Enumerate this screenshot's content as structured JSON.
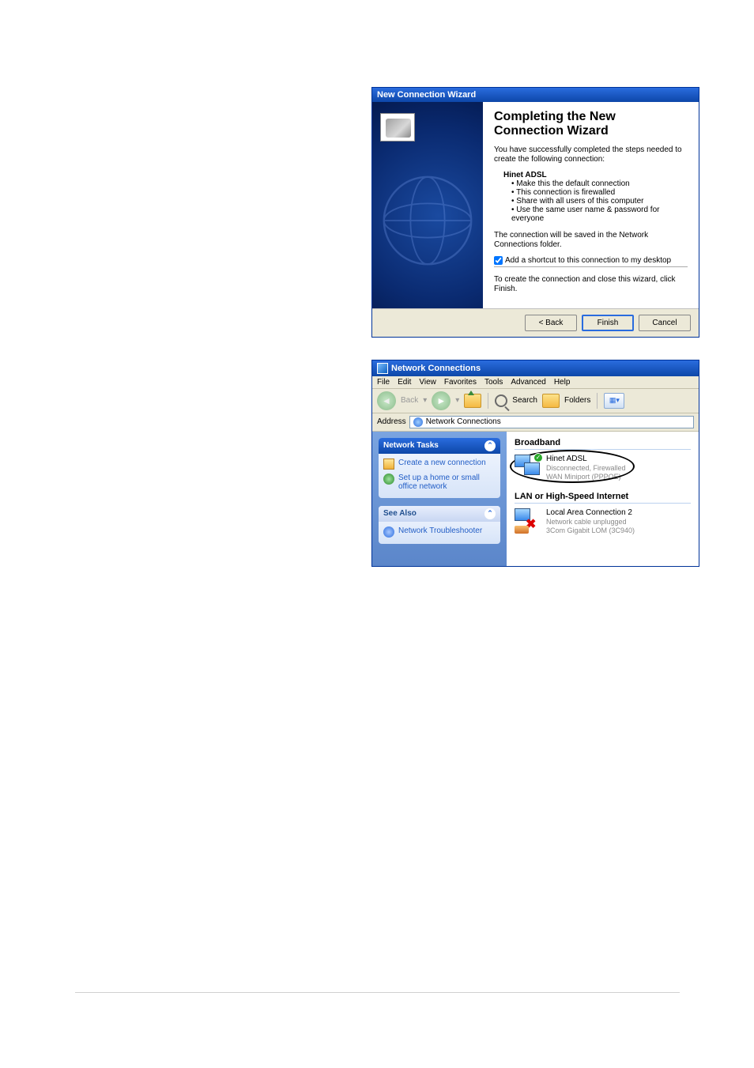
{
  "wizard": {
    "title": "New Connection Wizard",
    "heading": "Completing the New Connection Wizard",
    "intro": "You have successfully completed the steps needed to create the following connection:",
    "connection_name": "Hinet ADSL",
    "bullets": [
      "Make this the default connection",
      "This connection is firewalled",
      "Share with all users of this computer",
      "Use the same user name & password for everyone"
    ],
    "saved_text": "The connection will be saved in the Network Connections folder.",
    "shortcut_label": "Add a shortcut to this connection to my desktop",
    "finish_text": "To create the connection and close this wizard, click Finish.",
    "buttons": {
      "back": "< Back",
      "finish": "Finish",
      "cancel": "Cancel"
    }
  },
  "explorer": {
    "title": "Network Connections",
    "menu": [
      "File",
      "Edit",
      "View",
      "Favorites",
      "Tools",
      "Advanced",
      "Help"
    ],
    "toolbar": {
      "back_label": "Back",
      "search_label": "Search",
      "folders_label": "Folders"
    },
    "address_label": "Address",
    "address_value": "Network Connections",
    "tasks": {
      "header": "Network Tasks",
      "items": [
        "Create a new connection",
        "Set up a home or small office network"
      ]
    },
    "seealso": {
      "header": "See Also",
      "items": [
        "Network Troubleshooter"
      ]
    },
    "categories": {
      "broadband": {
        "header": "Broadband",
        "item": {
          "name": "Hinet ADSL",
          "status": "Disconnected, Firewalled",
          "device": "WAN Miniport (PPPOE)"
        }
      },
      "lan": {
        "header": "LAN or High-Speed Internet",
        "item": {
          "name": "Local Area Connection 2",
          "status": "Network cable unplugged",
          "device": "3Com Gigabit LOM (3C940)"
        }
      }
    }
  }
}
